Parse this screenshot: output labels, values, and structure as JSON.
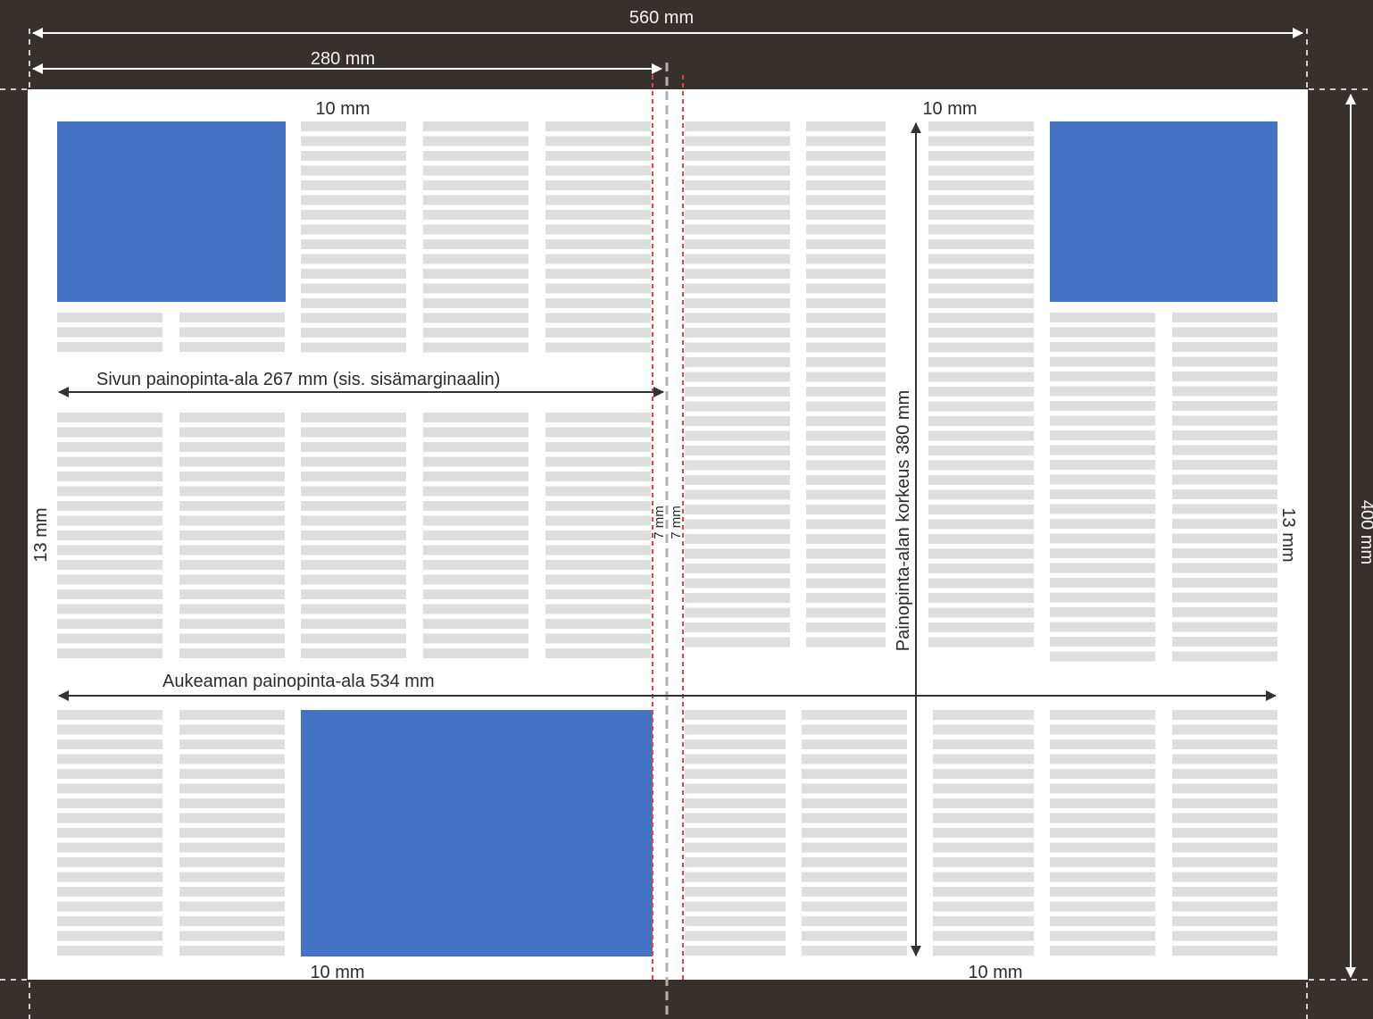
{
  "labels": {
    "spread_width": "560 mm",
    "page_width": "280 mm",
    "spread_height": "400 mm",
    "top_margin_left": "10 mm",
    "top_margin_right": "10 mm",
    "bottom_margin_left": "10 mm",
    "bottom_margin_right": "10 mm",
    "outer_margin_left": "13 mm",
    "outer_margin_right": "13 mm",
    "inner_margin_left": "7 mm",
    "inner_margin_right": "7 mm",
    "page_print_area": "Sivun painopinta-ala 267 mm (sis. sisämarginaalin)",
    "spread_print_area": "Aukeaman painopinta-ala 534 mm",
    "print_area_height": "Painopinta-alan korkeus 380 mm"
  },
  "colors": {
    "background": "#37302d",
    "paper": "#ffffff",
    "text_lines": "#dedede",
    "image_blocks": "#4472c4",
    "arrows": "#333333",
    "fold_line": "#b0b0b0",
    "inner_margin_lines": "#e8404a"
  }
}
